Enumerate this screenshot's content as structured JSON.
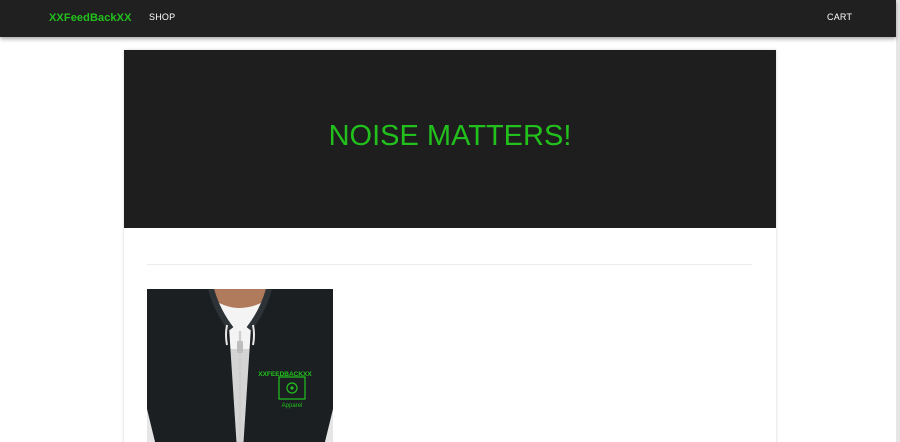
{
  "navbar": {
    "brand": "XXFeedBackXX",
    "shop_label": "SHOP",
    "cart_label": "CART",
    "background": "#202020",
    "brand_color": "#22c01c"
  },
  "hero": {
    "title": "NOISE MATTERS!",
    "background": "#1e1e1e",
    "title_color": "#22c01c"
  },
  "product": {
    "image": "black-zip-hoodie-photo",
    "logo": {
      "line1": "XXFEEDBACKXX",
      "line2": "Apparel"
    }
  }
}
